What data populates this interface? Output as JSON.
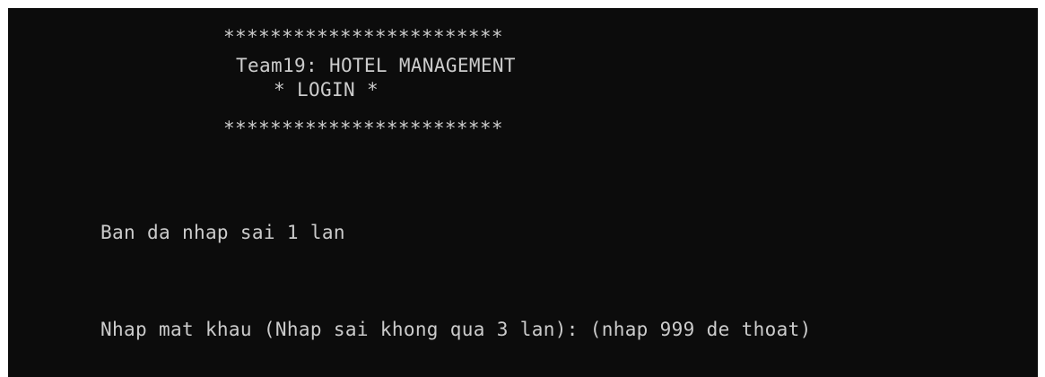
{
  "console": {
    "lines": [
      "************************",
      "Team19: HOTEL MANAGEMENT",
      "* LOGIN *",
      "************************",
      "Ban da nhap sai 1 lan",
      "Nhap mat khau (Nhap sai khong qua 3 lan): (nhap 999 de thoat)"
    ],
    "background_color": "#0c0c0c",
    "text_color": "#cccccc"
  }
}
